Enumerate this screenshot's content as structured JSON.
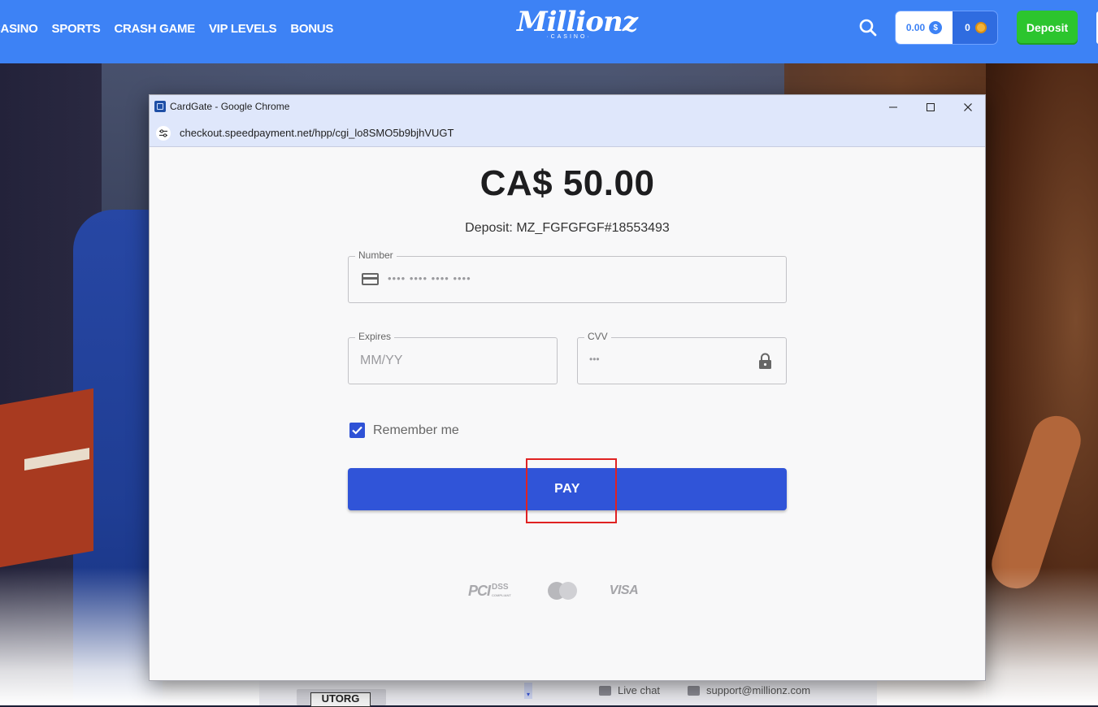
{
  "site": {
    "nav": [
      {
        "label": "CASINO"
      },
      {
        "label": "SPORTS"
      },
      {
        "label": "CRASH GAME"
      },
      {
        "label": "VIP LEVELS"
      },
      {
        "label": "BONUS"
      }
    ],
    "logo": {
      "main": "Millionz",
      "sub": "·CASINO·"
    },
    "balance": {
      "cash": "0.00",
      "cash_icon": "$",
      "bonus": "0"
    },
    "deposit_label": "Deposit",
    "footer": {
      "select_text": "UTORG",
      "live_chat": "Live chat",
      "support_email": "support@millionz.com"
    }
  },
  "popup": {
    "window_title": "CardGate - Google Chrome",
    "url": "checkout.speedpayment.net/hpp/cgi_lo8SMO5b9bjhVUGT",
    "amount": "CA$ 50.00",
    "deposit_ref": "Deposit: MZ_FGFGFGF#18553493",
    "fields": {
      "number": {
        "label": "Number",
        "placeholder": "•••• •••• •••• ••••"
      },
      "expires": {
        "label": "Expires",
        "placeholder": "MM/YY"
      },
      "cvv": {
        "label": "CVV",
        "placeholder": "•••"
      }
    },
    "remember_label": "Remember me",
    "remember_checked": true,
    "pay_label": "PAY",
    "payment_logos": {
      "pci": "PCI",
      "dss": "DSS",
      "dss_sub": "COMPLIANT",
      "visa": "VISA"
    }
  },
  "colors": {
    "header_blue": "#3d82f5",
    "pay_button": "#3054d8",
    "deposit_green": "#2cc52e",
    "highlight_red": "#e02222"
  }
}
